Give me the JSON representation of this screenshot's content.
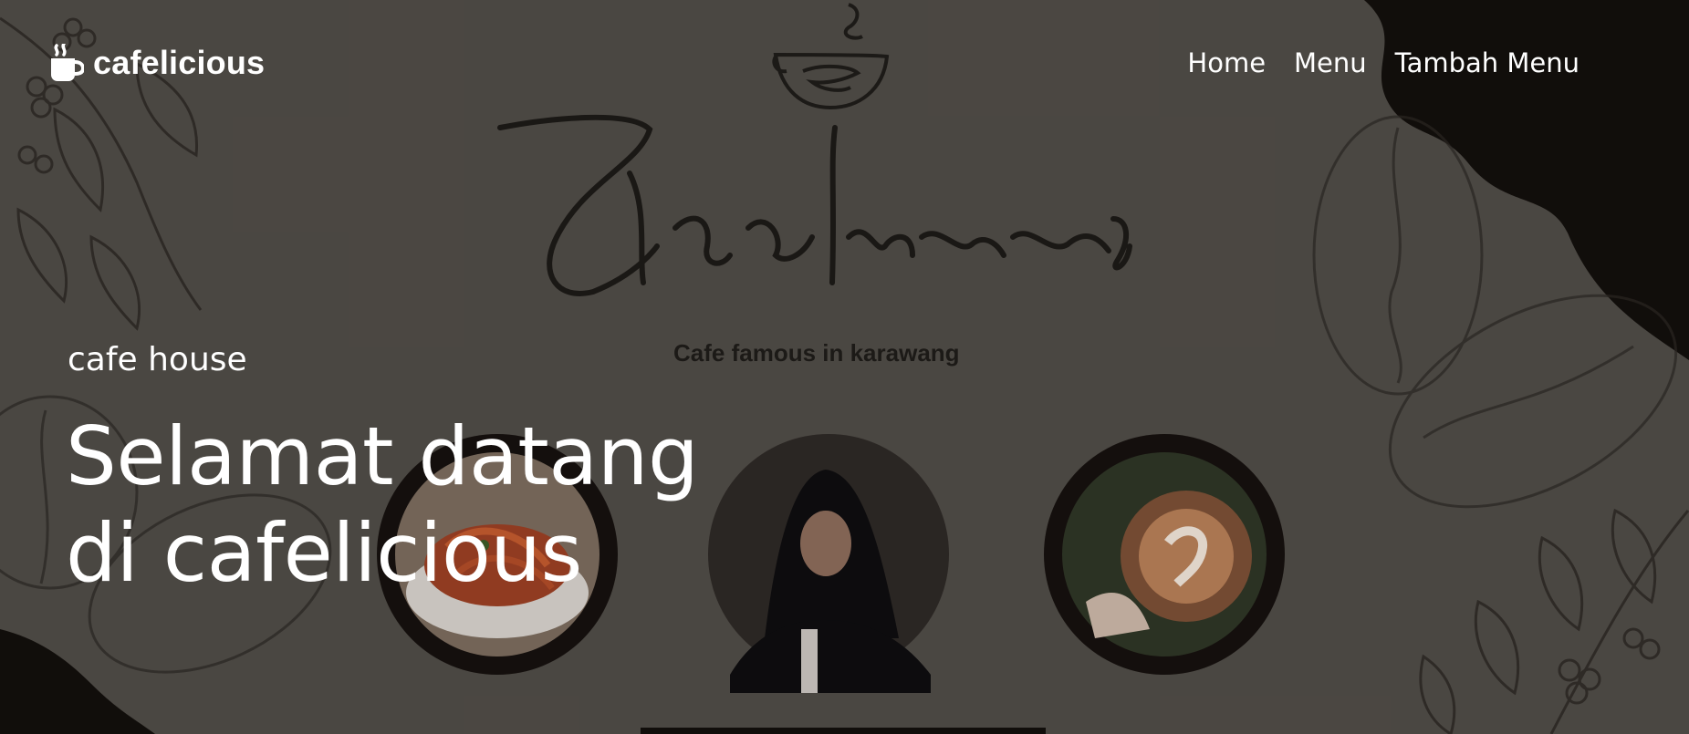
{
  "brand": {
    "name": "cafelicious",
    "icon": "coffee-cup-icon"
  },
  "nav": {
    "items": [
      {
        "label": "Home"
      },
      {
        "label": "Menu"
      },
      {
        "label": "Tambah Menu"
      }
    ]
  },
  "hero": {
    "tagline": "cafe house",
    "title_line1": "Selamat datang",
    "title_line2": "di cafelicious"
  },
  "banner": {
    "script_logo": "Cafelicious",
    "caption": "Cafe famous in karawang",
    "photos": [
      "spaghetti-photo",
      "person-photo",
      "latte-art-photo"
    ]
  },
  "colors": {
    "background": "#4e4a45",
    "dark_blob": "#100c09",
    "text": "#ffffff",
    "sketch": "#2c2825"
  }
}
